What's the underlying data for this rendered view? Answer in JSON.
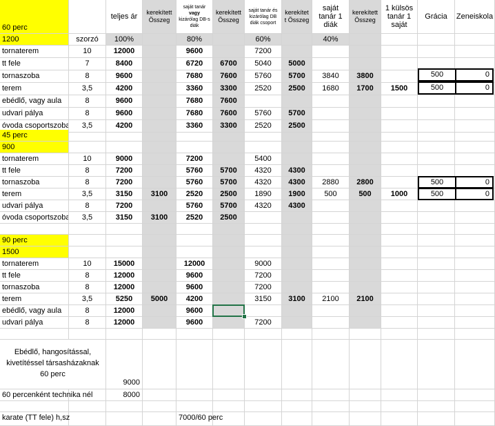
{
  "headers": {
    "h_b": "",
    "h_c": "teljes ár",
    "h_d": "kerekített Összeg",
    "h_e_1": "saját tanár",
    "h_e_2": "vagy",
    "h_e_3": "kizárólag DB-s diák",
    "h_f": "kerekített Összeg",
    "h_g": "saját tanár és kizárólag DB diák csoport",
    "h_h": "kerekítet t Összeg",
    "h_i": "saját tanár 1 diák",
    "h_j": "kerekített Összeg",
    "h_k": "1 külsös tanár 1 saját",
    "h_l": "Grácia",
    "h_m": "Zeneiskola"
  },
  "block60": {
    "title": "60 perc",
    "base": "1200",
    "multiplier_label": "szorzó",
    "pct_full": "100%",
    "pct_e": "80%",
    "pct_g": "60%",
    "pct_i": "40%",
    "rows": [
      {
        "name": "tornaterem",
        "mult": "10",
        "full": "12000",
        "d": "",
        "e": "9600",
        "f": "",
        "g": "7200",
        "h": "",
        "i": "",
        "j": "",
        "k": ""
      },
      {
        "name": "tt fele",
        "mult": "7",
        "full": "8400",
        "d": "",
        "e": "6720",
        "f": "6700",
        "g": "5040",
        "h": "5000",
        "i": "",
        "j": "",
        "k": ""
      },
      {
        "name": "tornaszoba",
        "mult": "8",
        "full": "9600",
        "d": "",
        "e": "7680",
        "f": "7600",
        "g": "5760",
        "h": "5700",
        "i": "3840",
        "j": "3800",
        "k": ""
      },
      {
        "name": "terem",
        "mult": "3,5",
        "full": "4200",
        "d": "",
        "e": "3360",
        "f": "3300",
        "g": "2520",
        "h": "2500",
        "i": "1680",
        "j": "1700",
        "k": "1500"
      },
      {
        "name": "ebédlő, vagy aula",
        "mult": "8",
        "full": "9600",
        "d": "",
        "e": "7680",
        "f": "7600",
        "g": "",
        "h": "",
        "i": "",
        "j": "",
        "k": ""
      },
      {
        "name": "udvari pálya",
        "mult": "8",
        "full": "9600",
        "d": "",
        "e": "7680",
        "f": "7600",
        "g": "5760",
        "h": "5700",
        "i": "",
        "j": "",
        "k": ""
      },
      {
        "name": "óvoda csoportszoba",
        "mult": "3,5",
        "full": "4200",
        "d": "",
        "e": "3360",
        "f": "3300",
        "g": "2520",
        "h": "2500",
        "i": "",
        "j": "",
        "k": ""
      }
    ],
    "extra": [
      {
        "gracia": "500",
        "zene": "0"
      },
      {
        "gracia": "500",
        "zene": "0"
      }
    ]
  },
  "block45": {
    "title": "45 perc",
    "base": "900",
    "rows": [
      {
        "name": "tornaterem",
        "mult": "10",
        "full": "9000",
        "d": "",
        "e": "7200",
        "f": "",
        "g": "5400",
        "h": "",
        "i": "",
        "j": "",
        "k": ""
      },
      {
        "name": "tt fele",
        "mult": "8",
        "full": "7200",
        "d": "",
        "e": "5760",
        "f": "5700",
        "g": "4320",
        "h": "4300",
        "i": "",
        "j": "",
        "k": ""
      },
      {
        "name": "tornaszoba",
        "mult": "8",
        "full": "7200",
        "d": "",
        "e": "5760",
        "f": "5700",
        "g": "4320",
        "h": "4300",
        "i": "2880",
        "j": "2800",
        "k": ""
      },
      {
        "name": "terem",
        "mult": "3,5",
        "full": "3150",
        "d": "3100",
        "e": "2520",
        "f": "2500",
        "g": "1890",
        "h": "1900",
        "i": "500",
        "j": "500",
        "k": "1000"
      },
      {
        "name": "udvari pálya",
        "mult": "8",
        "full": "7200",
        "d": "",
        "e": "5760",
        "f": "5700",
        "g": "4320",
        "h": "4300",
        "i": "",
        "j": "",
        "k": ""
      },
      {
        "name": "óvoda csoportszoba",
        "mult": "3,5",
        "full": "3150",
        "d": "3100",
        "e": "2520",
        "f": "2500",
        "g": "",
        "h": "",
        "i": "",
        "j": "",
        "k": ""
      }
    ],
    "extra": [
      {
        "gracia": "500",
        "zene": "0"
      },
      {
        "gracia": "500",
        "zene": "0"
      }
    ]
  },
  "block90": {
    "title": "90 perc",
    "base": "1500",
    "rows": [
      {
        "name": "tornaterem",
        "mult": "10",
        "full": "15000",
        "d": "",
        "e": "12000",
        "f": "",
        "g": "9000",
        "h": "",
        "i": "",
        "j": "",
        "k": ""
      },
      {
        "name": "tt fele",
        "mult": "8",
        "full": "12000",
        "d": "",
        "e": "9600",
        "f": "",
        "g": "7200",
        "h": "",
        "i": "",
        "j": "",
        "k": ""
      },
      {
        "name": "tornaszoba",
        "mult": "8",
        "full": "12000",
        "d": "",
        "e": "9600",
        "f": "",
        "g": "7200",
        "h": "",
        "i": "",
        "j": "",
        "k": ""
      },
      {
        "name": "terem",
        "mult": "3,5",
        "full": "5250",
        "d": "5000",
        "e": "4200",
        "f": "",
        "g": "3150",
        "h": "3100",
        "i": "2100",
        "j": "2100",
        "k": ""
      },
      {
        "name": "ebédlő, vagy aula",
        "mult": "8",
        "full": "12000",
        "d": "",
        "e": "9600",
        "f": "",
        "g": "",
        "h": "",
        "i": "",
        "j": "",
        "k": ""
      },
      {
        "name": "udvari pálya",
        "mult": "8",
        "full": "12000",
        "d": "",
        "e": "9600",
        "f": "",
        "g": "7200",
        "h": "",
        "i": "",
        "j": "",
        "k": ""
      }
    ]
  },
  "footer": {
    "ebedlo_text": "Ebédlő, hangosítással, kivetítéssel társasházaknak 60 perc",
    "ebedlo_value": "9000",
    "technika_label": "60 percenként technika nél",
    "technika_value": "8000",
    "karate_label": "karate (TT fele) h,sz",
    "karate_value": "7000/60 perc"
  }
}
